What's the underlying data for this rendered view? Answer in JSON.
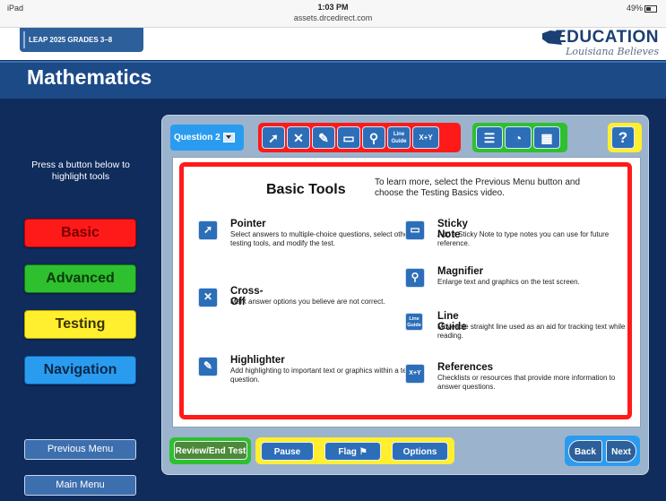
{
  "status_bar": {
    "device": "iPad",
    "time": "1:03 PM",
    "url": "assets.drcedirect.com",
    "battery": "49%"
  },
  "banner": {
    "program": "LEAP 2025 GRADES 3–8",
    "logo_word": "EDUCATION",
    "logo_tagline": "Louisiana Believes"
  },
  "subject": "Mathematics",
  "sidebar": {
    "instructions": "Press a button below to highlight tools",
    "categories": [
      {
        "label": "Basic",
        "color": "#ff1a1a"
      },
      {
        "label": "Advanced",
        "color": "#2ec02e"
      },
      {
        "label": "Testing",
        "color": "#ffef2e"
      },
      {
        "label": "Navigation",
        "color": "#2a9cf0"
      }
    ],
    "previous_menu": "Previous Menu",
    "main_menu": "Main Menu"
  },
  "toolbar": {
    "question_label": "Question 2",
    "basic_tools": [
      "pointer-icon",
      "cross-off-icon",
      "highlighter-icon",
      "sticky-note-icon",
      "magnifier-icon",
      "line-guide-icon",
      "references-icon"
    ],
    "line_guide_icon_text": "Line Guide",
    "references_icon_text": "X+Y",
    "advanced_tools": [
      "notepad-icon",
      "compass-icon",
      "grid-icon"
    ],
    "help": "?"
  },
  "panel": {
    "title": "Basic Tools",
    "learn_more": "To learn more, select the Previous Menu button and choose the Testing Basics video.",
    "left_items": [
      {
        "name": "Pointer",
        "desc": "Select answers to multiple-choice questions, select other testing tools, and modify the test."
      },
      {
        "name": "Cross-Off",
        "desc": "Mark answer options you believe are not correct."
      },
      {
        "name": "Highlighter",
        "desc": "Add highlighting to important text or graphics within a test question."
      }
    ],
    "right_items": [
      {
        "name": "Sticky Note",
        "desc": "Add a Sticky Note to type notes you can use for future reference."
      },
      {
        "name": "Magnifier",
        "desc": "Enlarge text and graphics on the test screen."
      },
      {
        "name": "Line Guide",
        "desc": "Moveable straight line used as an aid for tracking text while reading."
      },
      {
        "name": "References",
        "desc": "Checklists or resources that provide more information to answer questions."
      }
    ]
  },
  "footer": {
    "review": "Review/End Test",
    "pause": "Pause",
    "flag": "Flag",
    "options": "Options",
    "back": "Back",
    "next": "Next"
  }
}
